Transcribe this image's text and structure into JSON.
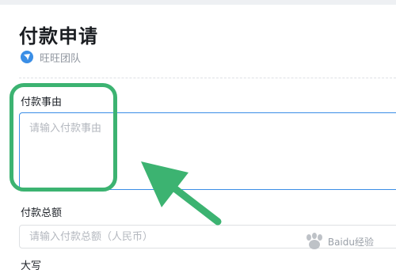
{
  "page": {
    "title": "付款申请",
    "team_name": "旺旺团队"
  },
  "form": {
    "reason": {
      "label": "付款事由",
      "placeholder": "请输入付款事由",
      "value": ""
    },
    "total": {
      "label": "付款总额",
      "placeholder": "请输入付款总额（人民币）",
      "value": ""
    },
    "uppercase": {
      "label": "大写"
    }
  },
  "annotation": {
    "highlight_color": "#3cb371"
  },
  "watermark": {
    "text": "Baidu经验",
    "icon": "baidu-paw-icon"
  },
  "colors": {
    "accent": "#3a8ee6",
    "placeholder": "#b4b8bf",
    "annotation_green": "#3cb371"
  }
}
